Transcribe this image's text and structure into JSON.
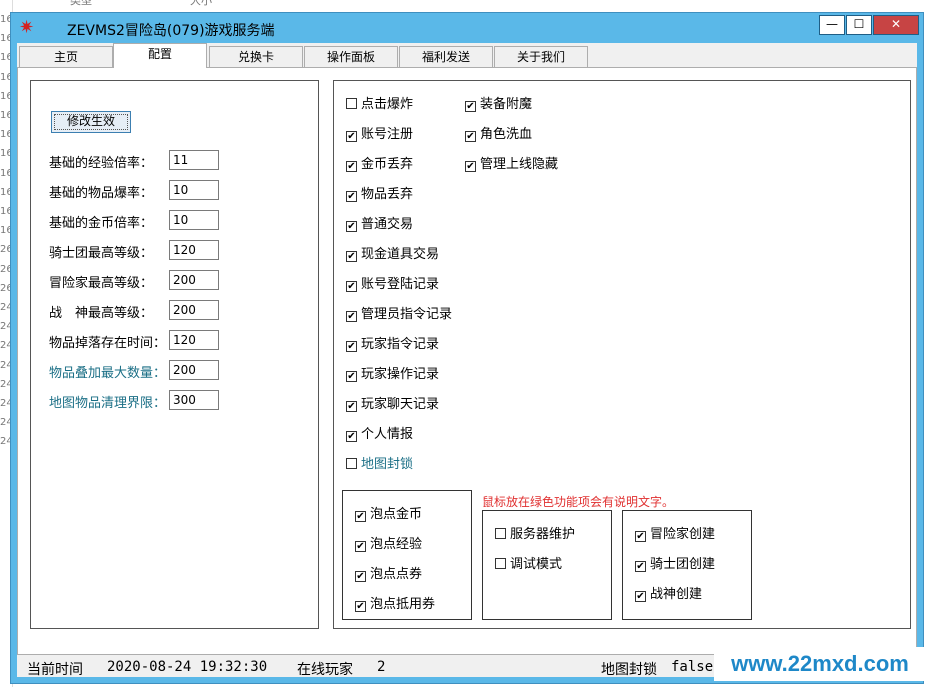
{
  "window": {
    "title": "ZEVMS2冒险岛(079)游戏服务端",
    "min": "—",
    "max": "☐",
    "close": "✕"
  },
  "tabs": [
    "主页",
    "配置",
    "兑换卡",
    "操作面板",
    "福利发送",
    "关于我们"
  ],
  "config": {
    "apply_label": "修改生效",
    "fields": [
      {
        "label": "基础的经验倍率：",
        "value": "11"
      },
      {
        "label": "基础的物品爆率：",
        "value": "10"
      },
      {
        "label": "基础的金币倍率：",
        "value": "10"
      },
      {
        "label": "骑士团最高等级：",
        "value": "120"
      },
      {
        "label": "冒险家最高等级：",
        "value": "200"
      },
      {
        "label": "战　神最高等级：",
        "value": "200"
      },
      {
        "label": "物品掉落存在时间：",
        "value": "120"
      },
      {
        "label": "物品叠加最大数量：",
        "value": "200"
      },
      {
        "label": "地图物品清理界限：",
        "value": "300"
      }
    ]
  },
  "options": {
    "col1": [
      {
        "label": "点击爆炸",
        "checked": false
      },
      {
        "label": "账号注册",
        "checked": true
      },
      {
        "label": "金币丢弃",
        "checked": true
      },
      {
        "label": "物品丢弃",
        "checked": true
      },
      {
        "label": "普通交易",
        "checked": true
      },
      {
        "label": "现金道具交易",
        "checked": true
      },
      {
        "label": "账号登陆记录",
        "checked": true
      },
      {
        "label": "管理员指令记录",
        "checked": true
      },
      {
        "label": "玩家指令记录",
        "checked": true
      },
      {
        "label": "玩家操作记录",
        "checked": true
      },
      {
        "label": "玩家聊天记录",
        "checked": true
      },
      {
        "label": "个人情报",
        "checked": true
      },
      {
        "label": "地图封锁",
        "checked": false
      }
    ],
    "col2": [
      {
        "label": "装备附魔",
        "checked": true
      },
      {
        "label": "角色洗血",
        "checked": true
      },
      {
        "label": "管理上线隐藏",
        "checked": true
      }
    ],
    "hint": "鼠标放在绿色功能项会有说明文字。",
    "group_bubble": [
      {
        "label": "泡点金币",
        "checked": true
      },
      {
        "label": "泡点经验",
        "checked": true
      },
      {
        "label": "泡点点券",
        "checked": true
      },
      {
        "label": "泡点抵用券",
        "checked": true
      }
    ],
    "group_server": [
      {
        "label": "服务器维护",
        "checked": false
      },
      {
        "label": "调试模式",
        "checked": false
      }
    ],
    "group_create": [
      {
        "label": "冒险家创建",
        "checked": true
      },
      {
        "label": "骑士团创建",
        "checked": true
      },
      {
        "label": "战神创建",
        "checked": true
      }
    ]
  },
  "status": {
    "time_label": "当前时间",
    "time_value": "2020-08-24 19:32:30",
    "online_label": "在线玩家",
    "online_value": "2",
    "mapblock_label": "地图封锁",
    "mapblock_value": "false"
  },
  "watermark": "www.22mxd.com",
  "background": {
    "top_labels": [
      "类型",
      "大小"
    ],
    "left_fragments": [
      "16",
      "16",
      "16",
      "16",
      "16",
      "16",
      "16",
      "16",
      "16",
      "16",
      "16",
      "16",
      "26",
      "26",
      "26",
      "24",
      "24",
      "24",
      "24",
      "24",
      "24",
      "24",
      "24"
    ]
  }
}
